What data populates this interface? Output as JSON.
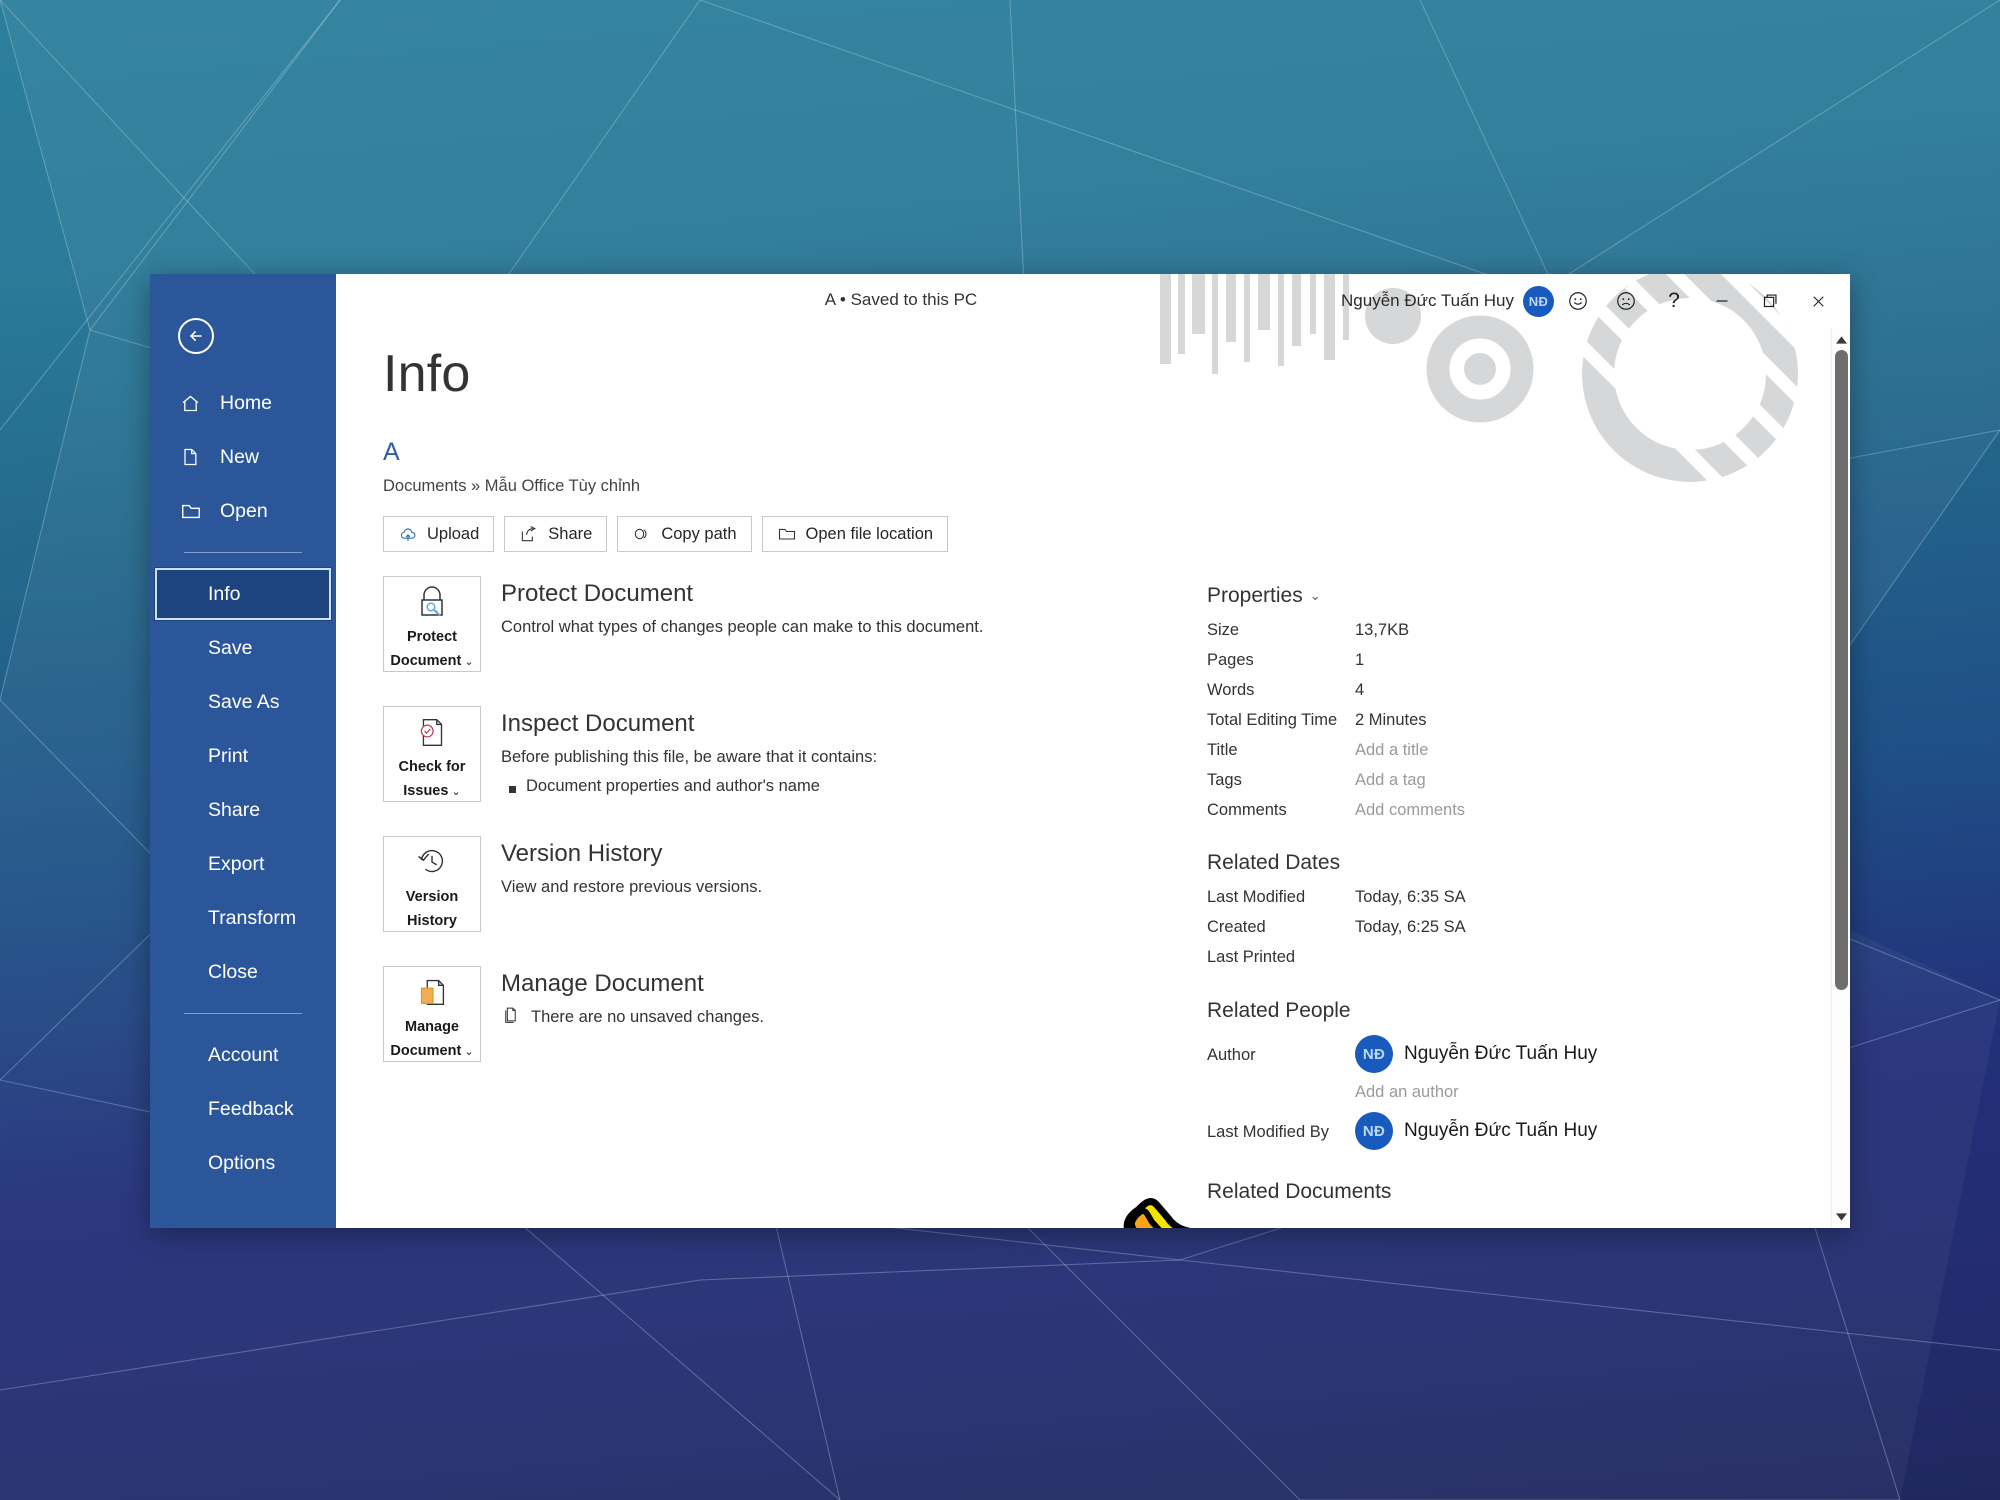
{
  "window": {
    "title_bar": {
      "document_status": "A • Saved to this PC",
      "user_name": "Nguyễn Đức Tuấn Huy",
      "avatar_initials": "NĐ",
      "help_label": "?",
      "icons": [
        "smiley-face-icon",
        "frowny-face-icon",
        "help-icon",
        "minimize-icon",
        "restore-icon",
        "close-icon"
      ]
    }
  },
  "sidebar": {
    "back_label": "Back",
    "items": [
      {
        "label": "Home",
        "icon": "home-icon",
        "selected": false
      },
      {
        "label": "New",
        "icon": "new-document-icon",
        "selected": false
      },
      {
        "label": "Open",
        "icon": "open-folder-icon",
        "selected": false
      },
      {
        "label": "Info",
        "icon": "",
        "selected": true
      },
      {
        "label": "Save",
        "icon": "",
        "selected": false
      },
      {
        "label": "Save As",
        "icon": "",
        "selected": false
      },
      {
        "label": "Print",
        "icon": "",
        "selected": false
      },
      {
        "label": "Share",
        "icon": "",
        "selected": false
      },
      {
        "label": "Export",
        "icon": "",
        "selected": false
      },
      {
        "label": "Transform",
        "icon": "",
        "selected": false
      },
      {
        "label": "Close",
        "icon": "",
        "selected": false
      },
      {
        "label": "Account",
        "icon": "",
        "selected": false
      },
      {
        "label": "Feedback",
        "icon": "",
        "selected": false
      },
      {
        "label": "Options",
        "icon": "",
        "selected": false
      }
    ]
  },
  "main": {
    "page_title": "Info",
    "file_name": "A",
    "breadcrumb": "Documents » Mẫu Office Tùy chỉnh",
    "actions": [
      {
        "label": "Upload",
        "icon": "cloud-upload-icon"
      },
      {
        "label": "Share",
        "icon": "share-icon"
      },
      {
        "label": "Copy path",
        "icon": "link-icon"
      },
      {
        "label": "Open file location",
        "icon": "folder-open-icon"
      }
    ],
    "sections": [
      {
        "button_label": "Protect\nDocument",
        "button_line1": "Protect",
        "button_line2": "Document",
        "has_chevron": true,
        "icon": "lock-key-icon",
        "title": "Protect Document",
        "description": "Control what types of changes people can make to this document."
      },
      {
        "button_line1": "Check for",
        "button_line2": "Issues",
        "has_chevron": true,
        "icon": "document-check-icon",
        "title": "Inspect Document",
        "description": "Before publishing this file, be aware that it contains:",
        "bullets": [
          "Document properties and author's name"
        ]
      },
      {
        "button_line1": "Version",
        "button_line2": "History",
        "has_chevron": false,
        "icon": "clock-history-icon",
        "title": "Version History",
        "description": "View and restore previous versions."
      },
      {
        "button_line1": "Manage",
        "button_line2": "Document",
        "has_chevron": true,
        "icon": "document-copy-icon",
        "title": "Manage Document",
        "status_icon": "document-pages-icon",
        "status_text": "There are no unsaved changes."
      }
    ]
  },
  "properties_panel": {
    "properties_heading": "Properties",
    "properties": [
      {
        "key": "Size",
        "value": "13,7KB",
        "placeholder": false
      },
      {
        "key": "Pages",
        "value": "1",
        "placeholder": false
      },
      {
        "key": "Words",
        "value": "4",
        "placeholder": false
      },
      {
        "key": "Total Editing Time",
        "value": "2 Minutes",
        "placeholder": false
      },
      {
        "key": "Title",
        "value": "Add a title",
        "placeholder": true
      },
      {
        "key": "Tags",
        "value": "Add a tag",
        "placeholder": true
      },
      {
        "key": "Comments",
        "value": "Add comments",
        "placeholder": true
      }
    ],
    "related_dates_heading": "Related Dates",
    "related_dates": [
      {
        "key": "Last Modified",
        "value": "Today, 6:35 SA"
      },
      {
        "key": "Created",
        "value": "Today, 6:25 SA"
      },
      {
        "key": "Last Printed",
        "value": ""
      }
    ],
    "related_people_heading": "Related People",
    "author_key": "Author",
    "author_name": "Nguyễn Đức Tuấn Huy",
    "author_initials": "NĐ",
    "add_author": "Add an author",
    "last_modified_by_key": "Last Modified By",
    "last_modified_by_name": "Nguyễn Đức Tuấn Huy",
    "last_modified_by_initials": "NĐ",
    "related_documents_heading": "Related Documents"
  },
  "colors": {
    "backstage_blue": "#2b579a",
    "selected_blue": "#1e4480",
    "avatar_blue": "#185abd",
    "file_name_blue": "#2f5e9e",
    "desktop_top": "#2c7f9c",
    "desktop_bottom": "#20275f"
  }
}
